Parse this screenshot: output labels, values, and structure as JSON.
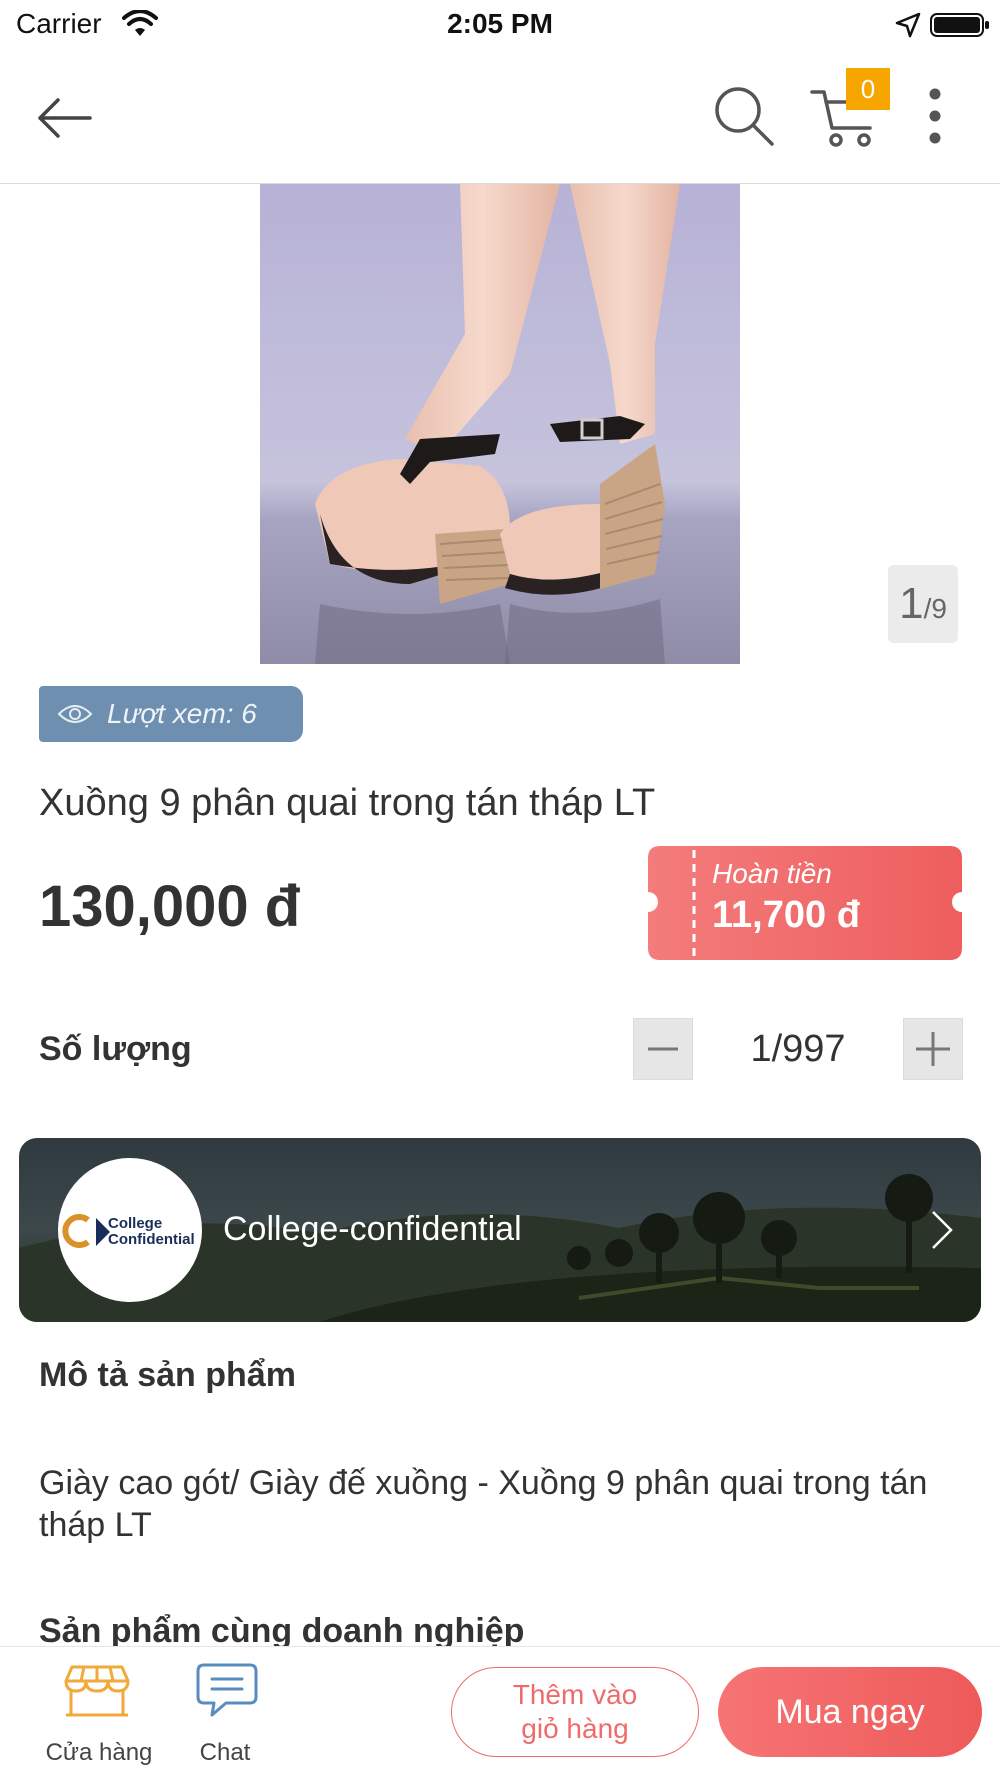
{
  "status_bar": {
    "carrier": "Carrier",
    "time": "2:05 PM"
  },
  "header": {
    "back_icon": "arrow-left-icon",
    "search_icon": "search-icon",
    "cart_icon": "cart-icon",
    "cart_count": "0",
    "more_icon": "more-vertical-icon"
  },
  "gallery": {
    "current": "1",
    "separator": "/",
    "total": "9"
  },
  "product": {
    "views_label": "Lượt xem: 6",
    "title": "Xuồng 9 phân quai trong tán tháp LT",
    "price": "130,000 đ",
    "cashback_label": "Hoàn tiền",
    "cashback_amount": "11,700 đ"
  },
  "quantity": {
    "label": "Số lượng",
    "value": "1/997"
  },
  "shop": {
    "logo_line1": "College",
    "logo_line2": "Confidential",
    "name": "College-confidential"
  },
  "description": {
    "title": "Mô tả sản phẩm",
    "text": "Giày cao gót/ Giày đế xuồng - Xuồng 9 phân quai trong tán tháp LT"
  },
  "related": {
    "title": "Sản phẩm cùng doanh nghiệp"
  },
  "bottom_bar": {
    "store_label": "Cửa hàng",
    "chat_label": "Chat",
    "add_to_cart_line1": "Thêm vào",
    "add_to_cart_line2": "giỏ hàng",
    "buy_now": "Mua ngay"
  },
  "colors": {
    "accent": "#ef6b6b",
    "badge": "#f7a600",
    "views_badge": "#6e8fb0",
    "store_icon": "#f2a93b",
    "chat_icon": "#5b8cc0"
  }
}
